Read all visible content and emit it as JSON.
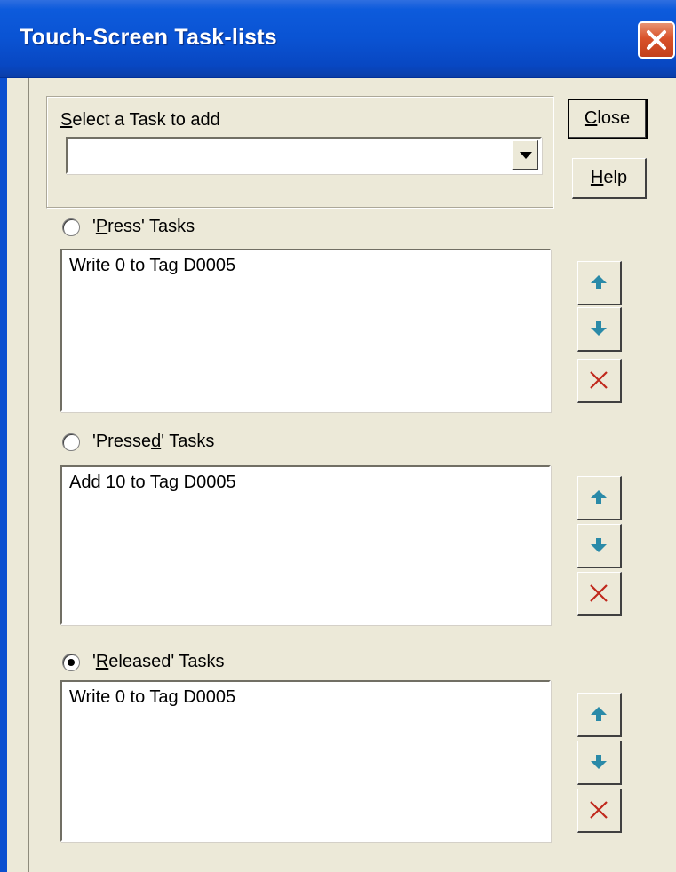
{
  "window": {
    "title": "Touch-Screen Task-lists"
  },
  "select_task": {
    "label_prefix": "",
    "label_mnemonic": "S",
    "label_suffix": "elect a Task to add",
    "value": ""
  },
  "buttons": {
    "close": {
      "mnemonic": "C",
      "rest": "lose"
    },
    "help": {
      "mnemonic": "H",
      "rest": "elp"
    }
  },
  "sections": [
    {
      "label_prefix": "'",
      "label_mnemonic": "P",
      "label_suffix": "ress' Tasks",
      "selected": false,
      "items": [
        "Write 0 to Tag D0005"
      ]
    },
    {
      "label_prefix": "'Presse",
      "label_mnemonic": "d",
      "label_suffix": "' Tasks",
      "selected": false,
      "items": [
        "Add 10 to Tag D0005"
      ]
    },
    {
      "label_prefix": "'",
      "label_mnemonic": "R",
      "label_suffix": "eleased' Tasks",
      "selected": true,
      "items": [
        "Write 0 to Tag D0005"
      ]
    }
  ],
  "icons": {
    "up": "arrow-up-icon",
    "down": "arrow-down-icon",
    "delete": "delete-x-icon"
  },
  "colors": {
    "title_bar": "#0a53d3",
    "arrow": "#2a8aa8",
    "delete": "#c0281c"
  }
}
